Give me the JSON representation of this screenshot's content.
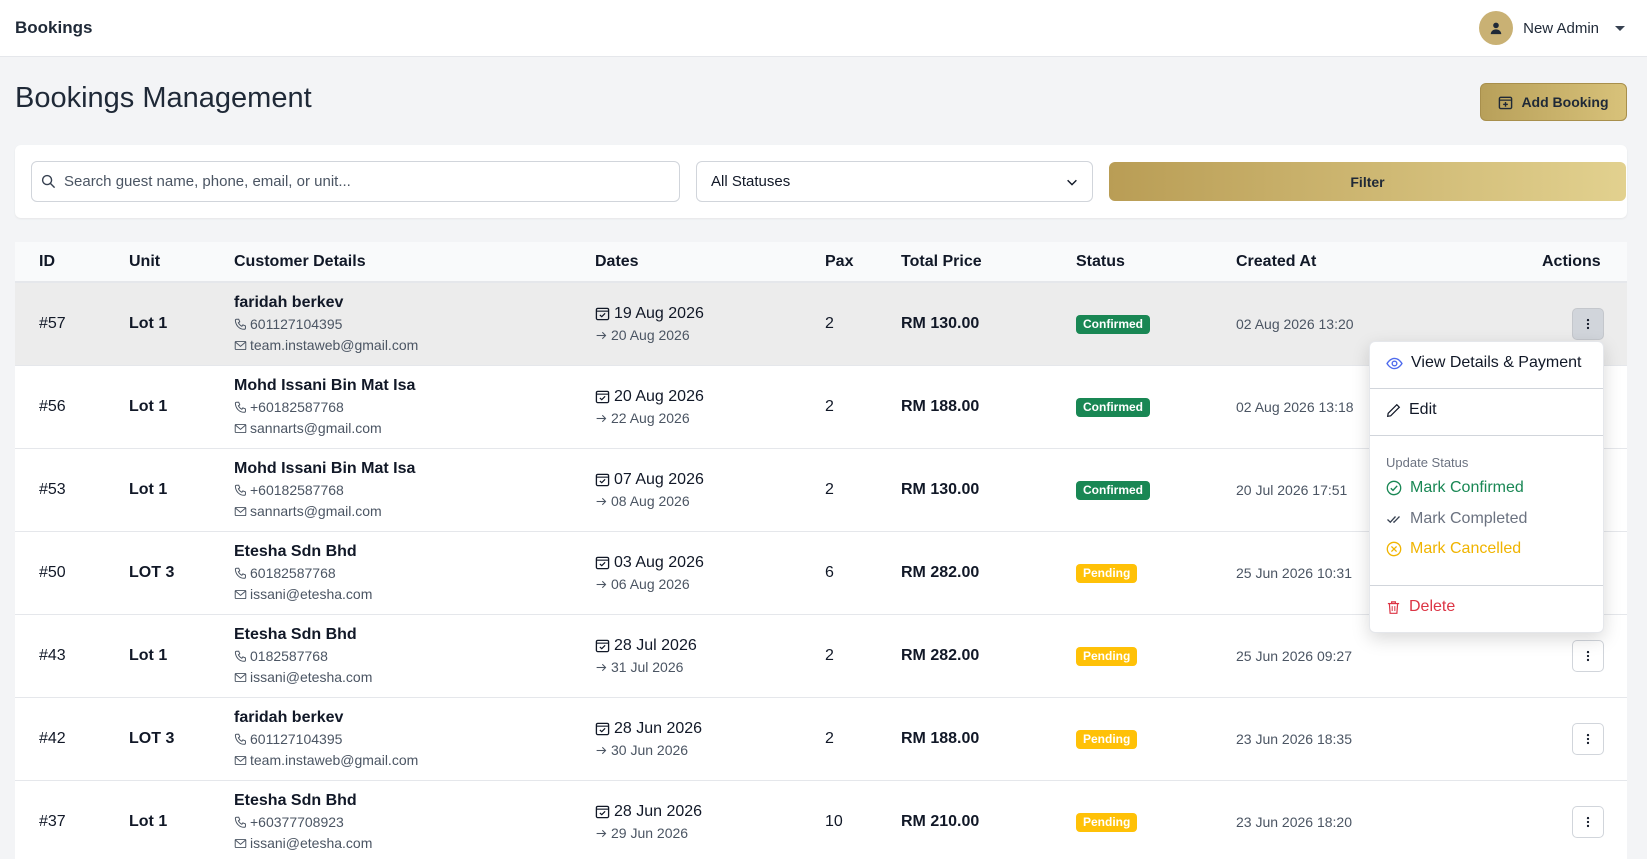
{
  "app": {
    "title": "Bookings",
    "user_name": "New Admin"
  },
  "page": {
    "title": "Bookings Management",
    "add_button": "Add Booking"
  },
  "filters": {
    "search_placeholder": "Search guest name, phone, email, or unit...",
    "search_value": "",
    "status_selected": "All Statuses",
    "filter_button": "Filter"
  },
  "table": {
    "headers": {
      "id": "ID",
      "unit": "Unit",
      "customer": "Customer Details",
      "dates": "Dates",
      "pax": "Pax",
      "price": "Total Price",
      "status": "Status",
      "created": "Created At",
      "actions": "Actions"
    },
    "rows": [
      {
        "id": "#57",
        "unit": "Lot 1",
        "name": "faridah berkev",
        "phone": "601127104395",
        "email": "team.instaweb@gmail.com",
        "check_in": "19 Aug 2026",
        "check_out": "20 Aug 2026",
        "pax": "2",
        "price": "RM 130.00",
        "status": "Confirmed",
        "created": "02 Aug 2026 13:20"
      },
      {
        "id": "#56",
        "unit": "Lot 1",
        "name": "Mohd Issani Bin Mat Isa",
        "phone": "+60182587768",
        "email": "sannarts@gmail.com",
        "check_in": "20 Aug 2026",
        "check_out": "22 Aug 2026",
        "pax": "2",
        "price": "RM 188.00",
        "status": "Confirmed",
        "created": "02 Aug 2026 13:18"
      },
      {
        "id": "#53",
        "unit": "Lot 1",
        "name": "Mohd Issani Bin Mat Isa",
        "phone": "+60182587768",
        "email": "sannarts@gmail.com",
        "check_in": "07 Aug 2026",
        "check_out": "08 Aug 2026",
        "pax": "2",
        "price": "RM 130.00",
        "status": "Confirmed",
        "created": "20 Jul 2026 17:51"
      },
      {
        "id": "#50",
        "unit": "LOT 3",
        "name": "Etesha Sdn Bhd",
        "phone": "60182587768",
        "email": "issani@etesha.com",
        "check_in": "03 Aug 2026",
        "check_out": "06 Aug 2026",
        "pax": "6",
        "price": "RM 282.00",
        "status": "Pending",
        "created": "25 Jun 2026 10:31"
      },
      {
        "id": "#43",
        "unit": "Lot 1",
        "name": "Etesha Sdn Bhd",
        "phone": "0182587768",
        "email": "issani@etesha.com",
        "check_in": "28 Jul 2026",
        "check_out": "31 Jul 2026",
        "pax": "2",
        "price": "RM 282.00",
        "status": "Pending",
        "created": "25 Jun 2026 09:27"
      },
      {
        "id": "#42",
        "unit": "LOT 3",
        "name": "faridah berkev",
        "phone": "601127104395",
        "email": "team.instaweb@gmail.com",
        "check_in": "28 Jun 2026",
        "check_out": "30 Jun 2026",
        "pax": "2",
        "price": "RM 188.00",
        "status": "Pending",
        "created": "23 Jun 2026 18:35"
      },
      {
        "id": "#37",
        "unit": "Lot 1",
        "name": "Etesha Sdn Bhd",
        "phone": "+60377708923",
        "email": "issani@etesha.com",
        "check_in": "28 Jun 2026",
        "check_out": "29 Jun 2026",
        "pax": "10",
        "price": "RM 210.00",
        "status": "Pending",
        "created": "23 Jun 2026 18:20"
      }
    ]
  },
  "action_menu": {
    "view": "View Details & Payment",
    "edit": "Edit",
    "update_status_header": "Update Status",
    "mark_confirmed": "Mark Confirmed",
    "mark_completed": "Mark Completed",
    "mark_cancelled": "Mark Cancelled",
    "delete": "Delete"
  },
  "colors": {
    "accent_gold": "#c9b174",
    "confirmed": "#198754",
    "pending": "#ffc107",
    "danger": "#dc3545",
    "view_icon": "#4f6bed"
  }
}
